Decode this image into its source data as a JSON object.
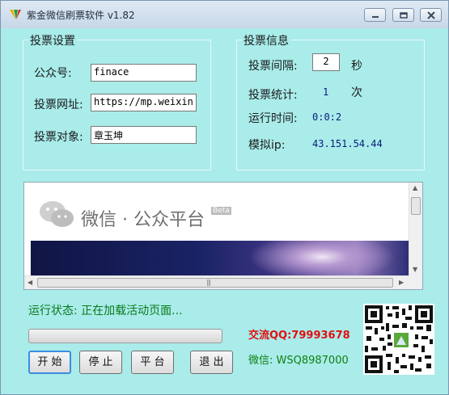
{
  "window": {
    "title": "紫金微信刷票软件 v1.82",
    "controls": [
      "minimize-icon",
      "restore-icon",
      "close-icon"
    ]
  },
  "settings": {
    "group_title": "投票设置",
    "account_label": "公众号:",
    "account_value": "finace",
    "url_label": "投票网址:",
    "url_value": "https://mp.weixin",
    "target_label": "投票对象:",
    "target_value": "章玉坤"
  },
  "info": {
    "group_title": "投票信息",
    "interval_label": "投票间隔:",
    "interval_value": "2",
    "interval_unit": "秒",
    "count_label": "投票统计:",
    "count_value": "1",
    "count_unit": "次",
    "runtime_label": "运行时间:",
    "runtime_value": "0:0:2",
    "ip_label": "模拟ip:",
    "ip_value": "43.151.54.44"
  },
  "browser": {
    "heading": "微信 · 公众平台",
    "badge": "Beta",
    "grip": "|||"
  },
  "status": {
    "text": "运行状态: 正在加载活动页面...",
    "progress": 0
  },
  "buttons": {
    "start": "开 始",
    "stop": "停 止",
    "platform": "平 台",
    "exit": "退 出"
  },
  "contact": {
    "qq": "交流QQ:79993678",
    "wechat": "微信: WSQ8987000"
  },
  "colors": {
    "background": "#a9ecea",
    "status_green": "#0a7a1a",
    "qq_red": "#e01010",
    "wechat_green": "#108010",
    "value_blue": "#0b1b7a"
  }
}
